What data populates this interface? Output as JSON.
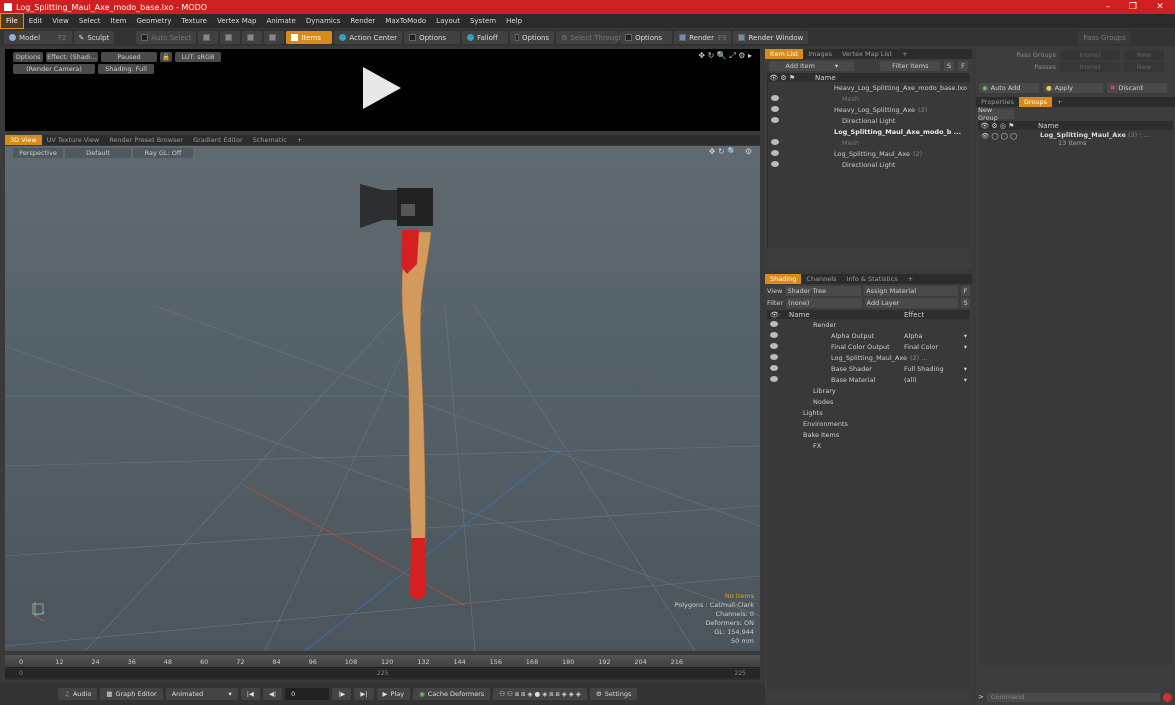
{
  "window": {
    "title": "Log_Splitting_Maul_Axe_modo_base.lxo - MODO"
  },
  "menu": [
    "File",
    "Edit",
    "View",
    "Select",
    "Item",
    "Geometry",
    "Texture",
    "Vertex Map",
    "Animate",
    "Dynamics",
    "Render",
    "MaxToModo",
    "Layout",
    "System",
    "Help"
  ],
  "toolbar": {
    "model": "Model",
    "f2": "F2",
    "sculpt": "Sculpt",
    "auto_select": "Auto Select",
    "items": "Items",
    "action_center": "Action Center",
    "options1": "Options",
    "falloff": "Falloff",
    "options2": "Options",
    "select_through": "Select Through",
    "options3": "Options",
    "render": "Render",
    "f9": "F9",
    "render_window": "Render Window"
  },
  "preview": {
    "options": "Options",
    "effect": "Effect: (Shadi...",
    "paused": "Paused",
    "lut": "LUT: sRGB",
    "camera": "(Render Camera)",
    "shading": "Shading: Full"
  },
  "viewport_tabs": [
    "3D View",
    "UV Texture View",
    "Render Preset Browser",
    "Gradient Editor",
    "Schematic",
    "+"
  ],
  "viewport": {
    "perspective": "Perspective",
    "default": "Default",
    "raygl": "Ray GL: Off",
    "stats": {
      "no_items": "No Items",
      "polygons": "Polygons : Catmull-Clark",
      "channels": "Channels: 0",
      "deformers": "Deformers: ON",
      "gl": "GL: 154,944",
      "focal": "50 mm"
    }
  },
  "timeline": {
    "ticks": [
      "0",
      "12",
      "24",
      "36",
      "48",
      "60",
      "72",
      "84",
      "96",
      "108",
      "120",
      "132",
      "144",
      "156",
      "168",
      "180",
      "192",
      "204",
      "216"
    ],
    "start": "0",
    "mid": "225",
    "end": "225"
  },
  "bottom": {
    "audio": "Audio",
    "graph_editor": "Graph Editor",
    "animated": "Animated",
    "frame": "0",
    "play": "Play",
    "cache": "Cache Deformers",
    "settings": "Settings"
  },
  "item_list": {
    "tabs": [
      "Item List",
      "Images",
      "Vertex Map List",
      "+"
    ],
    "add_item": "Add Item",
    "filter_items": "Filter Items",
    "s": "S",
    "f": "F",
    "col_name": "Name",
    "rows": [
      {
        "label": "Heavy_Log_Splitting_Axe_modo_base.lxo",
        "indent": 20,
        "eye": false
      },
      {
        "label": "Mesh",
        "indent": 28,
        "eye": true,
        "dim": true
      },
      {
        "label": "Heavy_Log_Splitting_Axe",
        "count": "(2)",
        "indent": 20,
        "eye": true
      },
      {
        "label": "Directional Light",
        "indent": 28,
        "eye": true
      },
      {
        "label": "Log_Splitting_Maul_Axe_modo_b ...",
        "indent": 20,
        "eye": false,
        "bold": true
      },
      {
        "label": "Mesh",
        "indent": 28,
        "eye": true,
        "dim": true
      },
      {
        "label": "Log_Splitting_Maul_Axe",
        "count": "(2)",
        "indent": 20,
        "eye": true
      },
      {
        "label": "Directional Light",
        "indent": 28,
        "eye": true
      }
    ]
  },
  "shading": {
    "tabs": [
      "Shading",
      "Channels",
      "Info & Statistics",
      "+"
    ],
    "view_label": "View",
    "view_value": "Shader Tree",
    "assign": "Assign Material",
    "f": "F",
    "filter_label": "Filter",
    "filter_value": "(none)",
    "add_layer": "Add Layer",
    "s": "S",
    "col_name": "Name",
    "col_effect": "Effect",
    "rows": [
      {
        "label": "Render",
        "effect": "",
        "indent": 30,
        "eye": true
      },
      {
        "label": "Alpha Output",
        "effect": "Alpha",
        "indent": 48,
        "eye": true
      },
      {
        "label": "Final Color Output",
        "effect": "Final Color",
        "indent": 48,
        "eye": true
      },
      {
        "label": "Log_Splitting_Maul_Axe",
        "count": "(2) ...",
        "effect": "",
        "indent": 48,
        "eye": true
      },
      {
        "label": "Base Shader",
        "effect": "Full Shading",
        "indent": 48,
        "eye": true
      },
      {
        "label": "Base Material",
        "effect": "(all)",
        "indent": 48,
        "eye": true
      },
      {
        "label": "Library",
        "effect": "",
        "indent": 30,
        "eye": false
      },
      {
        "label": "Nodes",
        "effect": "",
        "indent": 30,
        "eye": false
      },
      {
        "label": "Lights",
        "effect": "",
        "indent": 20,
        "eye": false
      },
      {
        "label": "Environments",
        "effect": "",
        "indent": 20,
        "eye": false
      },
      {
        "label": "Bake Items",
        "effect": "",
        "indent": 20,
        "eye": false
      },
      {
        "label": "FX",
        "effect": "",
        "indent": 30,
        "eye": false
      }
    ]
  },
  "right": {
    "pass_groups": "Pass Groups",
    "passes": "Passes",
    "none1": "(none)",
    "none2": "(none)",
    "new1": "New",
    "new2": "New",
    "auto_add": "Auto Add",
    "apply": "Apply",
    "discard": "Discard",
    "tabs": [
      "Properties",
      "Groups",
      "+"
    ],
    "new_group": "New Group",
    "col_name": "Name",
    "group_name": "Log_Splitting_Maul_Axe",
    "group_count": "(3) : ...",
    "group_items": "13 Items",
    "command": "Command"
  },
  "colors": {
    "accent": "#d98b1a",
    "title": "#cf1f20",
    "handle": "#d29a5c",
    "grip": "#d42020"
  }
}
